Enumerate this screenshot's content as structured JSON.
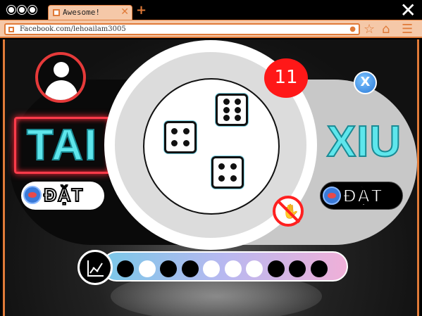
{
  "browser": {
    "tab_title": "Awesome!",
    "tab_close": "✕",
    "new_tab": "+",
    "window_close": "✕",
    "url": "Facebook.com/lehoailam3005"
  },
  "game": {
    "tai_label": "TAI",
    "xiu_label": "XIU",
    "bet_left_label": "ĐẶT",
    "bet_right_label": "ĐẶT",
    "close_button": "X",
    "timer": "11",
    "dice": [
      4,
      6,
      4
    ],
    "history": [
      "black",
      "white",
      "black",
      "black",
      "white",
      "white",
      "white",
      "black",
      "black",
      "black"
    ],
    "colors": {
      "accent": "#e07a38",
      "tai_glow": "#ff3b4a",
      "label_cyan": "#5ee6ec",
      "timer_red": "#ff1818"
    }
  }
}
